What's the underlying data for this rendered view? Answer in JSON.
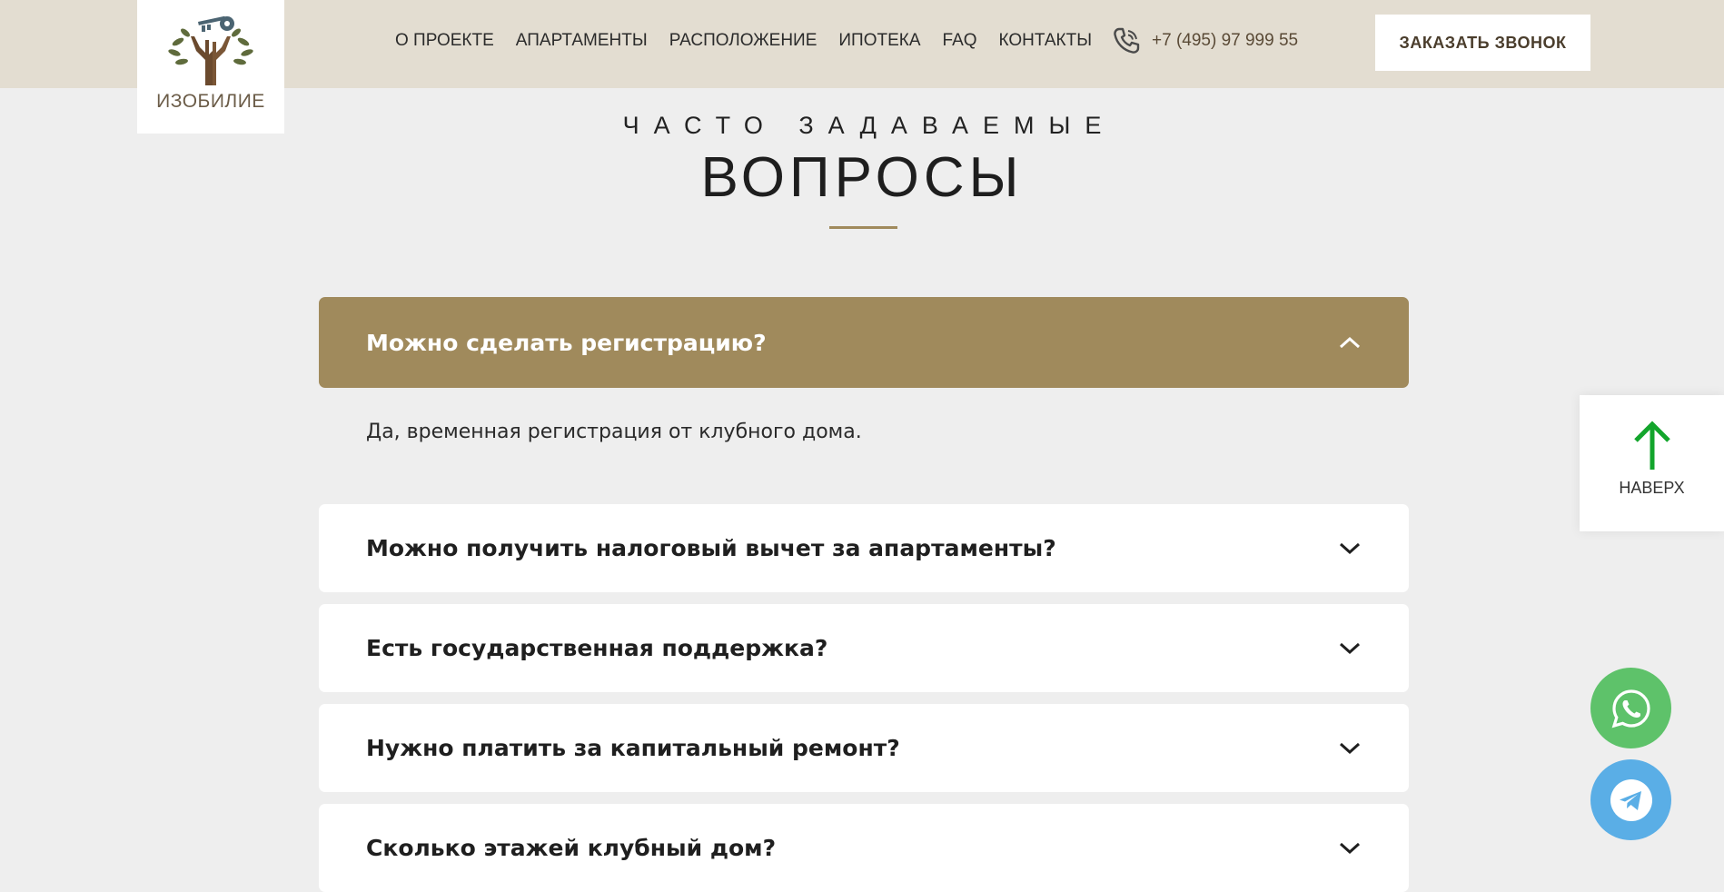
{
  "header": {
    "logo_text": "ИЗОБИЛИЕ",
    "nav": [
      "О ПРОЕКТЕ",
      "АПАРТАМЕНТЫ",
      "РАСПОЛОЖЕНИЕ",
      "ИПОТЕКА",
      "FAQ",
      "КОНТАКТЫ"
    ],
    "phone": "+7 (495) 97 999 55",
    "phone_icon": "phone-icon",
    "call_button": "ЗАКАЗАТЬ ЗВОНОК"
  },
  "section": {
    "subtitle": "ЧАСТО ЗАДАВАЕМЫЕ",
    "title": "ВОПРОСЫ"
  },
  "faq": [
    {
      "question": "Можно сделать регистрацию?",
      "expanded": true,
      "answer": "Да, временная регистрация от клубного дома."
    },
    {
      "question": "Можно получить налоговый вычет за апартаменты?",
      "expanded": false
    },
    {
      "question": "Есть государственная поддержка?",
      "expanded": false
    },
    {
      "question": "Нужно платить за капитальный ремонт?",
      "expanded": false
    },
    {
      "question": "Сколько этажей клубный дом?",
      "expanded": false
    }
  ],
  "scroll_top": {
    "label": "НАВЕРХ",
    "icon": "arrow-up-icon"
  },
  "messengers": [
    {
      "name": "whatsapp",
      "icon": "whatsapp-icon",
      "color": "#5ec26a"
    },
    {
      "name": "telegram",
      "icon": "telegram-icon",
      "color": "#5aaee6"
    }
  ],
  "colors": {
    "accent": "#a08a5c",
    "header_bg": "#e3ddd1",
    "page_bg": "#eeeeee",
    "arrow_green": "#13a52c"
  }
}
